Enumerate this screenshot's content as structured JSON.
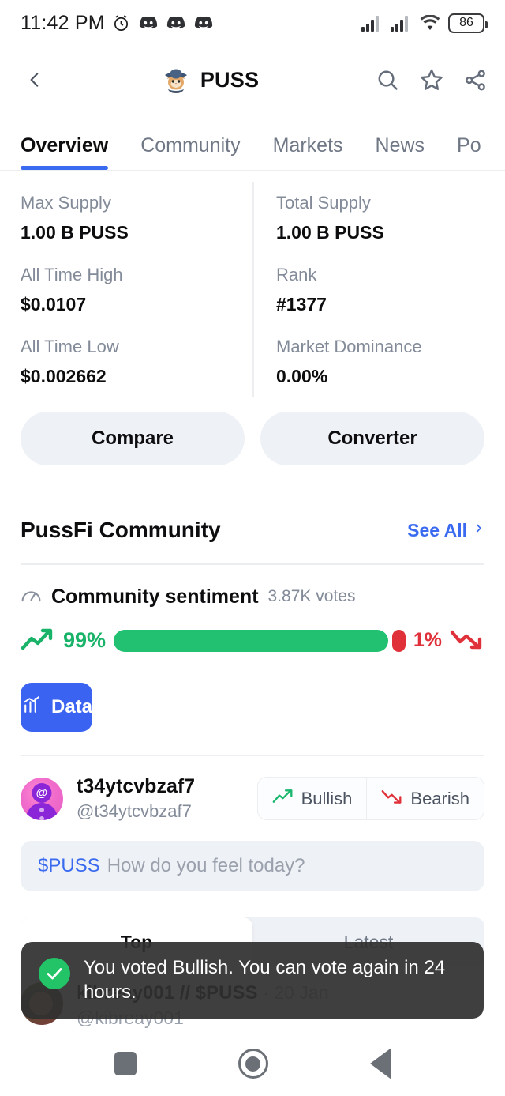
{
  "status_bar": {
    "time": "11:42 PM",
    "battery_level": "86",
    "icons": [
      "alarm-clock-icon",
      "discord-icon",
      "discord-icon",
      "discord-icon",
      "signal-icon",
      "signal-icon",
      "wifi-icon",
      "battery-icon"
    ]
  },
  "app_bar": {
    "back_icon": "chevron-left-icon",
    "coin_symbol": "PUSS",
    "logo_icon": "puss-cat-logo",
    "actions": [
      "search-icon",
      "star-icon",
      "share-icon"
    ]
  },
  "tabs": [
    {
      "label": "Overview",
      "active": true
    },
    {
      "label": "Community",
      "active": false
    },
    {
      "label": "Markets",
      "active": false
    },
    {
      "label": "News",
      "active": false
    },
    {
      "label": "Po",
      "active": false
    }
  ],
  "stats": [
    {
      "label": "Max Supply",
      "value": "1.00 B PUSS"
    },
    {
      "label": "Total Supply",
      "value": "1.00 B PUSS"
    },
    {
      "label": "All Time High",
      "value": "$0.0107"
    },
    {
      "label": "Rank",
      "value": "#1377"
    },
    {
      "label": "All Time Low",
      "value": "$0.002662"
    },
    {
      "label": "Market Dominance",
      "value": "0.00%"
    }
  ],
  "actions": {
    "compare_label": "Compare",
    "converter_label": "Converter"
  },
  "community": {
    "title": "PussFi Community",
    "see_all_label": "See All",
    "see_all_chevron": "chevron-right-icon"
  },
  "sentiment": {
    "icon": "gauge-icon",
    "title": "Community sentiment",
    "votes": "3.87K votes",
    "bullish_pct": "99%",
    "bearish_pct": "1%",
    "bullish_value": 99,
    "bearish_value": 1,
    "bullish_color": "#22c171",
    "bearish_color": "#e0313a",
    "data_button_label": "Data",
    "data_button_icon": "bar-chart-icon"
  },
  "user": {
    "name": "t34ytcvbzaf7",
    "handle": "@t34ytcvbzaf7",
    "avatar_icon": "user-avatar",
    "bullish_label": "Bullish",
    "bearish_label": "Bearish"
  },
  "composer": {
    "ticker": "$PUSS",
    "placeholder": "How do you feel today?"
  },
  "feed_tabs": [
    {
      "label": "Top",
      "active": true
    },
    {
      "label": "Latest",
      "active": false
    }
  ],
  "post": {
    "author": "kibreay001",
    "separator": "//",
    "ticker": "$PUSS",
    "date": "· 20 Jan",
    "handle": "@kibreay001"
  },
  "toast": {
    "message": "You voted Bullish. You can vote again in 24 hours.",
    "icon": "check-circle-icon"
  },
  "nav_bar": {
    "recents_icon": "square-icon",
    "home_icon": "circle-icon",
    "back_icon": "triangle-back-icon"
  }
}
